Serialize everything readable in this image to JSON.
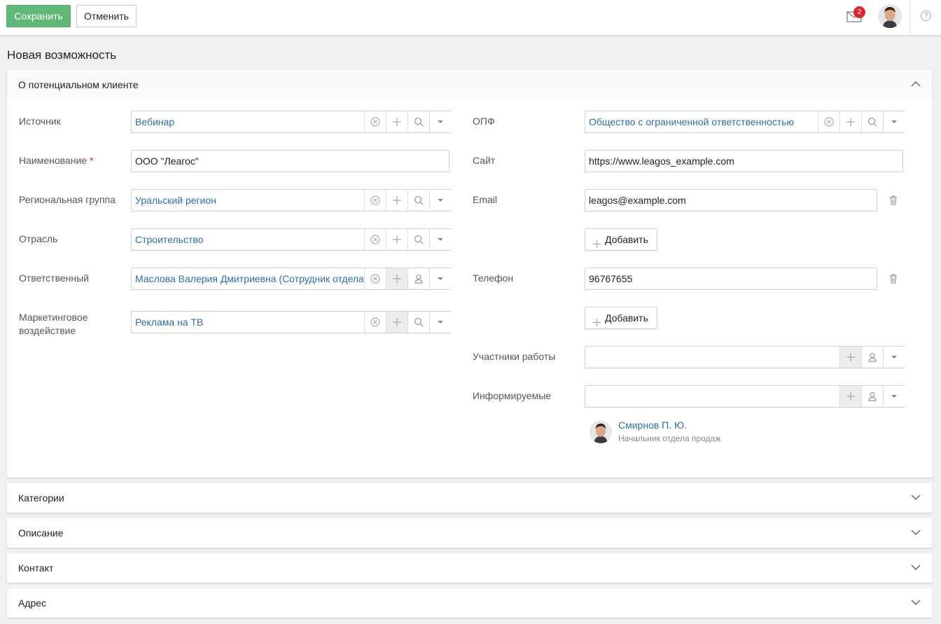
{
  "toolbar": {
    "save_label": "Сохранить",
    "cancel_label": "Отменить",
    "mail_count": "2",
    "help_icon": "?"
  },
  "page": {
    "title": "Новая возможность"
  },
  "sections": {
    "lead": {
      "title": "О потенциальном клиенте"
    },
    "categories": {
      "title": "Категории"
    },
    "description": {
      "title": "Описание"
    },
    "contact": {
      "title": "Контакт"
    },
    "address": {
      "title": "Адрес"
    }
  },
  "fields": {
    "source": {
      "label": "Источник",
      "value": "Вебинар"
    },
    "name": {
      "label": "Наименование",
      "required_mark": "*",
      "value": "ООО \"Леагос\""
    },
    "region": {
      "label": "Региональная группа",
      "value": "Уральский регион"
    },
    "industry": {
      "label": "Отрасль",
      "value": "Строительство"
    },
    "responsible": {
      "label": "Ответственный",
      "value": "Маслова Валерия Дмитриевна (Сотрудник отдела"
    },
    "marketing": {
      "label": "Маркетинговое воздействие",
      "value": "Реклама на ТВ"
    },
    "opf": {
      "label": "ОПФ",
      "value": "Общество с ограниченной ответственностью"
    },
    "site": {
      "label": "Сайт",
      "value": "https://www.leagos_example.com"
    },
    "email": {
      "label": "Email",
      "value": "leagos@example.com",
      "add_label": "Добавить"
    },
    "phone": {
      "label": "Телефон",
      "value": "96767655",
      "add_label": "Добавить"
    },
    "participants": {
      "label": "Участники работы",
      "value": ""
    },
    "informed": {
      "label": "Информируемые",
      "value": ""
    }
  },
  "informed_person": {
    "name": "Смирнов П. Ю.",
    "role": "Начальник отдела продаж"
  },
  "colors": {
    "primary": "#5fb877",
    "link": "#2e6da4",
    "badge": "#e0262c",
    "required": "#d0202c"
  }
}
